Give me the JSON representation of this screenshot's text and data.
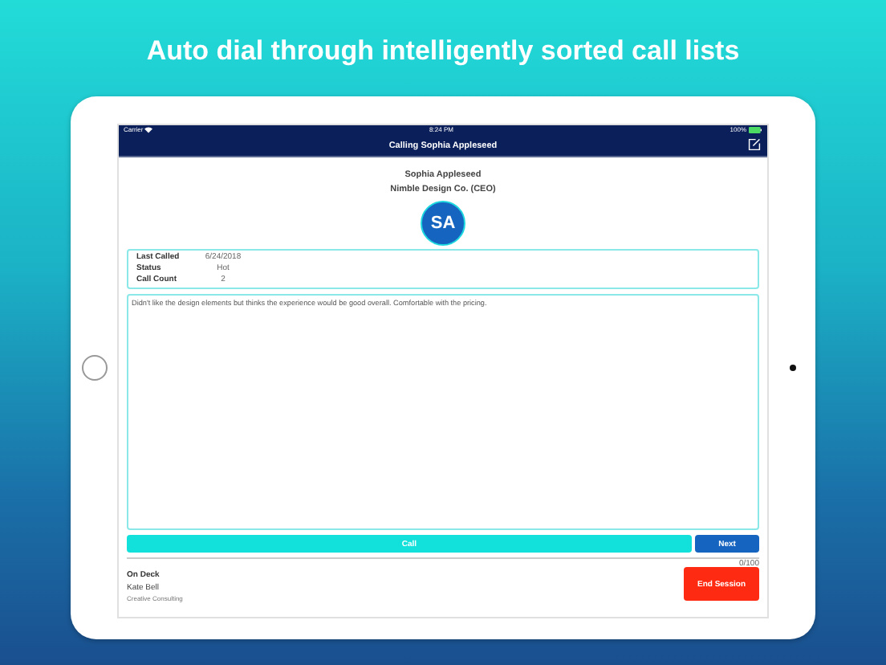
{
  "headline": "Auto dial through intelligently sorted call lists",
  "status_bar": {
    "carrier": "Carrier",
    "time": "8:24 PM",
    "battery": "100%"
  },
  "nav": {
    "title": "Calling Sophia Appleseed"
  },
  "contact": {
    "name": "Sophia Appleseed",
    "company": "Nimble Design Co. (CEO)",
    "initials": "SA"
  },
  "details": [
    {
      "label": "Last Called",
      "value": "6/24/2018"
    },
    {
      "label": "Status",
      "value": "Hot"
    },
    {
      "label": "Call Count",
      "value": "2"
    }
  ],
  "notes": "Didn't like the design elements but thinks the experience would be good overall. Comfortable with the pricing.",
  "call_button": "Call",
  "next_button": "Next",
  "counter": "0/100",
  "on_deck": {
    "label": "On Deck",
    "name": "Kate Bell",
    "company": "Creative Consulting"
  },
  "end_button": "End Session"
}
